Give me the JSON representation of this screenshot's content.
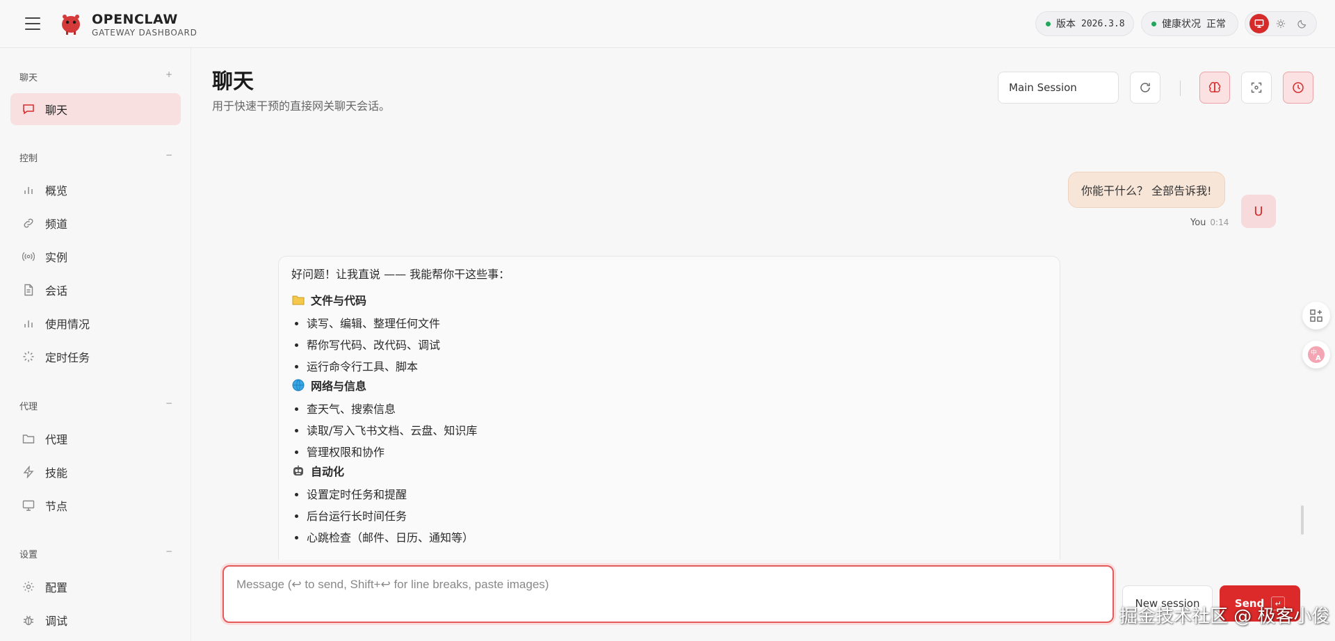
{
  "header": {
    "brand_title": "OPENCLAW",
    "brand_subtitle": "GATEWAY DASHBOARD",
    "version_label": "版本",
    "version_value": "2026.3.8",
    "health_label": "健康状况",
    "health_value": "正常"
  },
  "sidebar": {
    "sections": [
      {
        "title": "聊天",
        "toggle": "+",
        "items": [
          {
            "label": "聊天",
            "icon": "message-square-icon",
            "active": true
          }
        ]
      },
      {
        "title": "控制",
        "toggle": "−",
        "items": [
          {
            "label": "概览",
            "icon": "bar-chart-icon"
          },
          {
            "label": "频道",
            "icon": "link-icon"
          },
          {
            "label": "实例",
            "icon": "radio-icon"
          },
          {
            "label": "会话",
            "icon": "file-text-icon"
          },
          {
            "label": "使用情况",
            "icon": "bar-chart-icon"
          },
          {
            "label": "定时任务",
            "icon": "loader-icon"
          }
        ]
      },
      {
        "title": "代理",
        "toggle": "−",
        "items": [
          {
            "label": "代理",
            "icon": "folder-icon"
          },
          {
            "label": "技能",
            "icon": "zap-icon"
          },
          {
            "label": "节点",
            "icon": "monitor-icon"
          }
        ]
      },
      {
        "title": "设置",
        "toggle": "−",
        "items": [
          {
            "label": "配置",
            "icon": "gear-icon"
          },
          {
            "label": "调试",
            "icon": "bug-icon"
          }
        ]
      }
    ]
  },
  "page": {
    "title": "聊天",
    "subtitle": "用于快速干预的直接网关聊天会话。",
    "session_select": "Main Session"
  },
  "chat": {
    "user_message": "你能干什么？ 全部告诉我!",
    "user_avatar": "U",
    "user_name": "You",
    "user_time": "0:14",
    "assistant": {
      "intro": "好问题！让我直说 —— 我能帮你干这些事：",
      "sections": [
        {
          "title": "文件与代码",
          "icon": "folder-emoji-icon",
          "items": [
            "读写、编辑、整理任何文件",
            "帮你写代码、改代码、调试",
            "运行命令行工具、脚本"
          ]
        },
        {
          "title": "网络与信息",
          "icon": "globe-emoji-icon",
          "items": [
            "查天气、搜索信息",
            "读取/写入飞书文档、云盘、知识库",
            "管理权限和协作"
          ]
        },
        {
          "title": "自动化",
          "icon": "robot-emoji-icon",
          "items": [
            "设置定时任务和提醒",
            "后台运行长时间任务",
            "心跳检查（邮件、日历、通知等）"
          ]
        }
      ]
    }
  },
  "composer": {
    "placeholder": "Message (↩ to send, Shift+↩ for line breaks, paste images)",
    "new_session_label": "New session",
    "send_label": "Send",
    "send_key": "↵"
  },
  "watermark": "掘金技术社区 @ 极客小俊",
  "colors": {
    "accent": "#dc2a2a",
    "active_nav_bg": "#f8dfe0",
    "status_ok": "#22a65a"
  }
}
